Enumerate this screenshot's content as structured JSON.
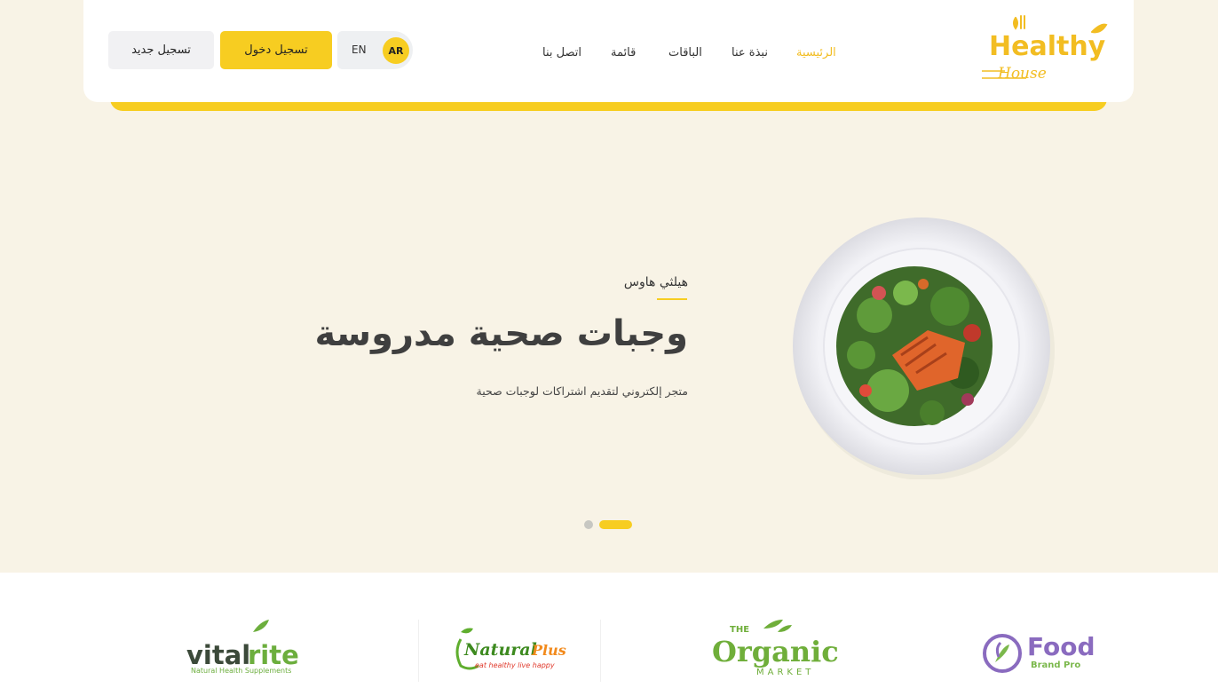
{
  "header": {
    "logo_text": "Healthy House",
    "nav": [
      {
        "label": "الرئيسية",
        "active": true
      },
      {
        "label": "نبذة عنا",
        "active": false
      },
      {
        "label": "الباقات",
        "active": false
      },
      {
        "label": "قائمة",
        "active": false
      },
      {
        "label": "اتصل بنا",
        "active": false
      }
    ],
    "lang": {
      "ar": "AR",
      "en": "EN"
    },
    "login_label": "تسجيل دخول",
    "register_label": "تسجيل جديد"
  },
  "hero": {
    "tagline": "هيلثي هاوس",
    "title": "وجبات صحية مدروسة",
    "subtitle": "متجر إلكتروني لتقديم اشتراكات لوجبات صحية",
    "slides": 2,
    "active_slide": 2
  },
  "brands": [
    {
      "name": "vitalrite",
      "tagline": "Natural Health Supplements"
    },
    {
      "name": "NaturalPlus",
      "tagline": "eat healthy live happy"
    },
    {
      "name": "The Organics Market",
      "tagline": ""
    },
    {
      "name": "Food",
      "tagline": "Brand Pro"
    }
  ],
  "colors": {
    "accent": "#f7cd21",
    "background": "#f8f3e6",
    "active_nav": "#f2bd22"
  }
}
